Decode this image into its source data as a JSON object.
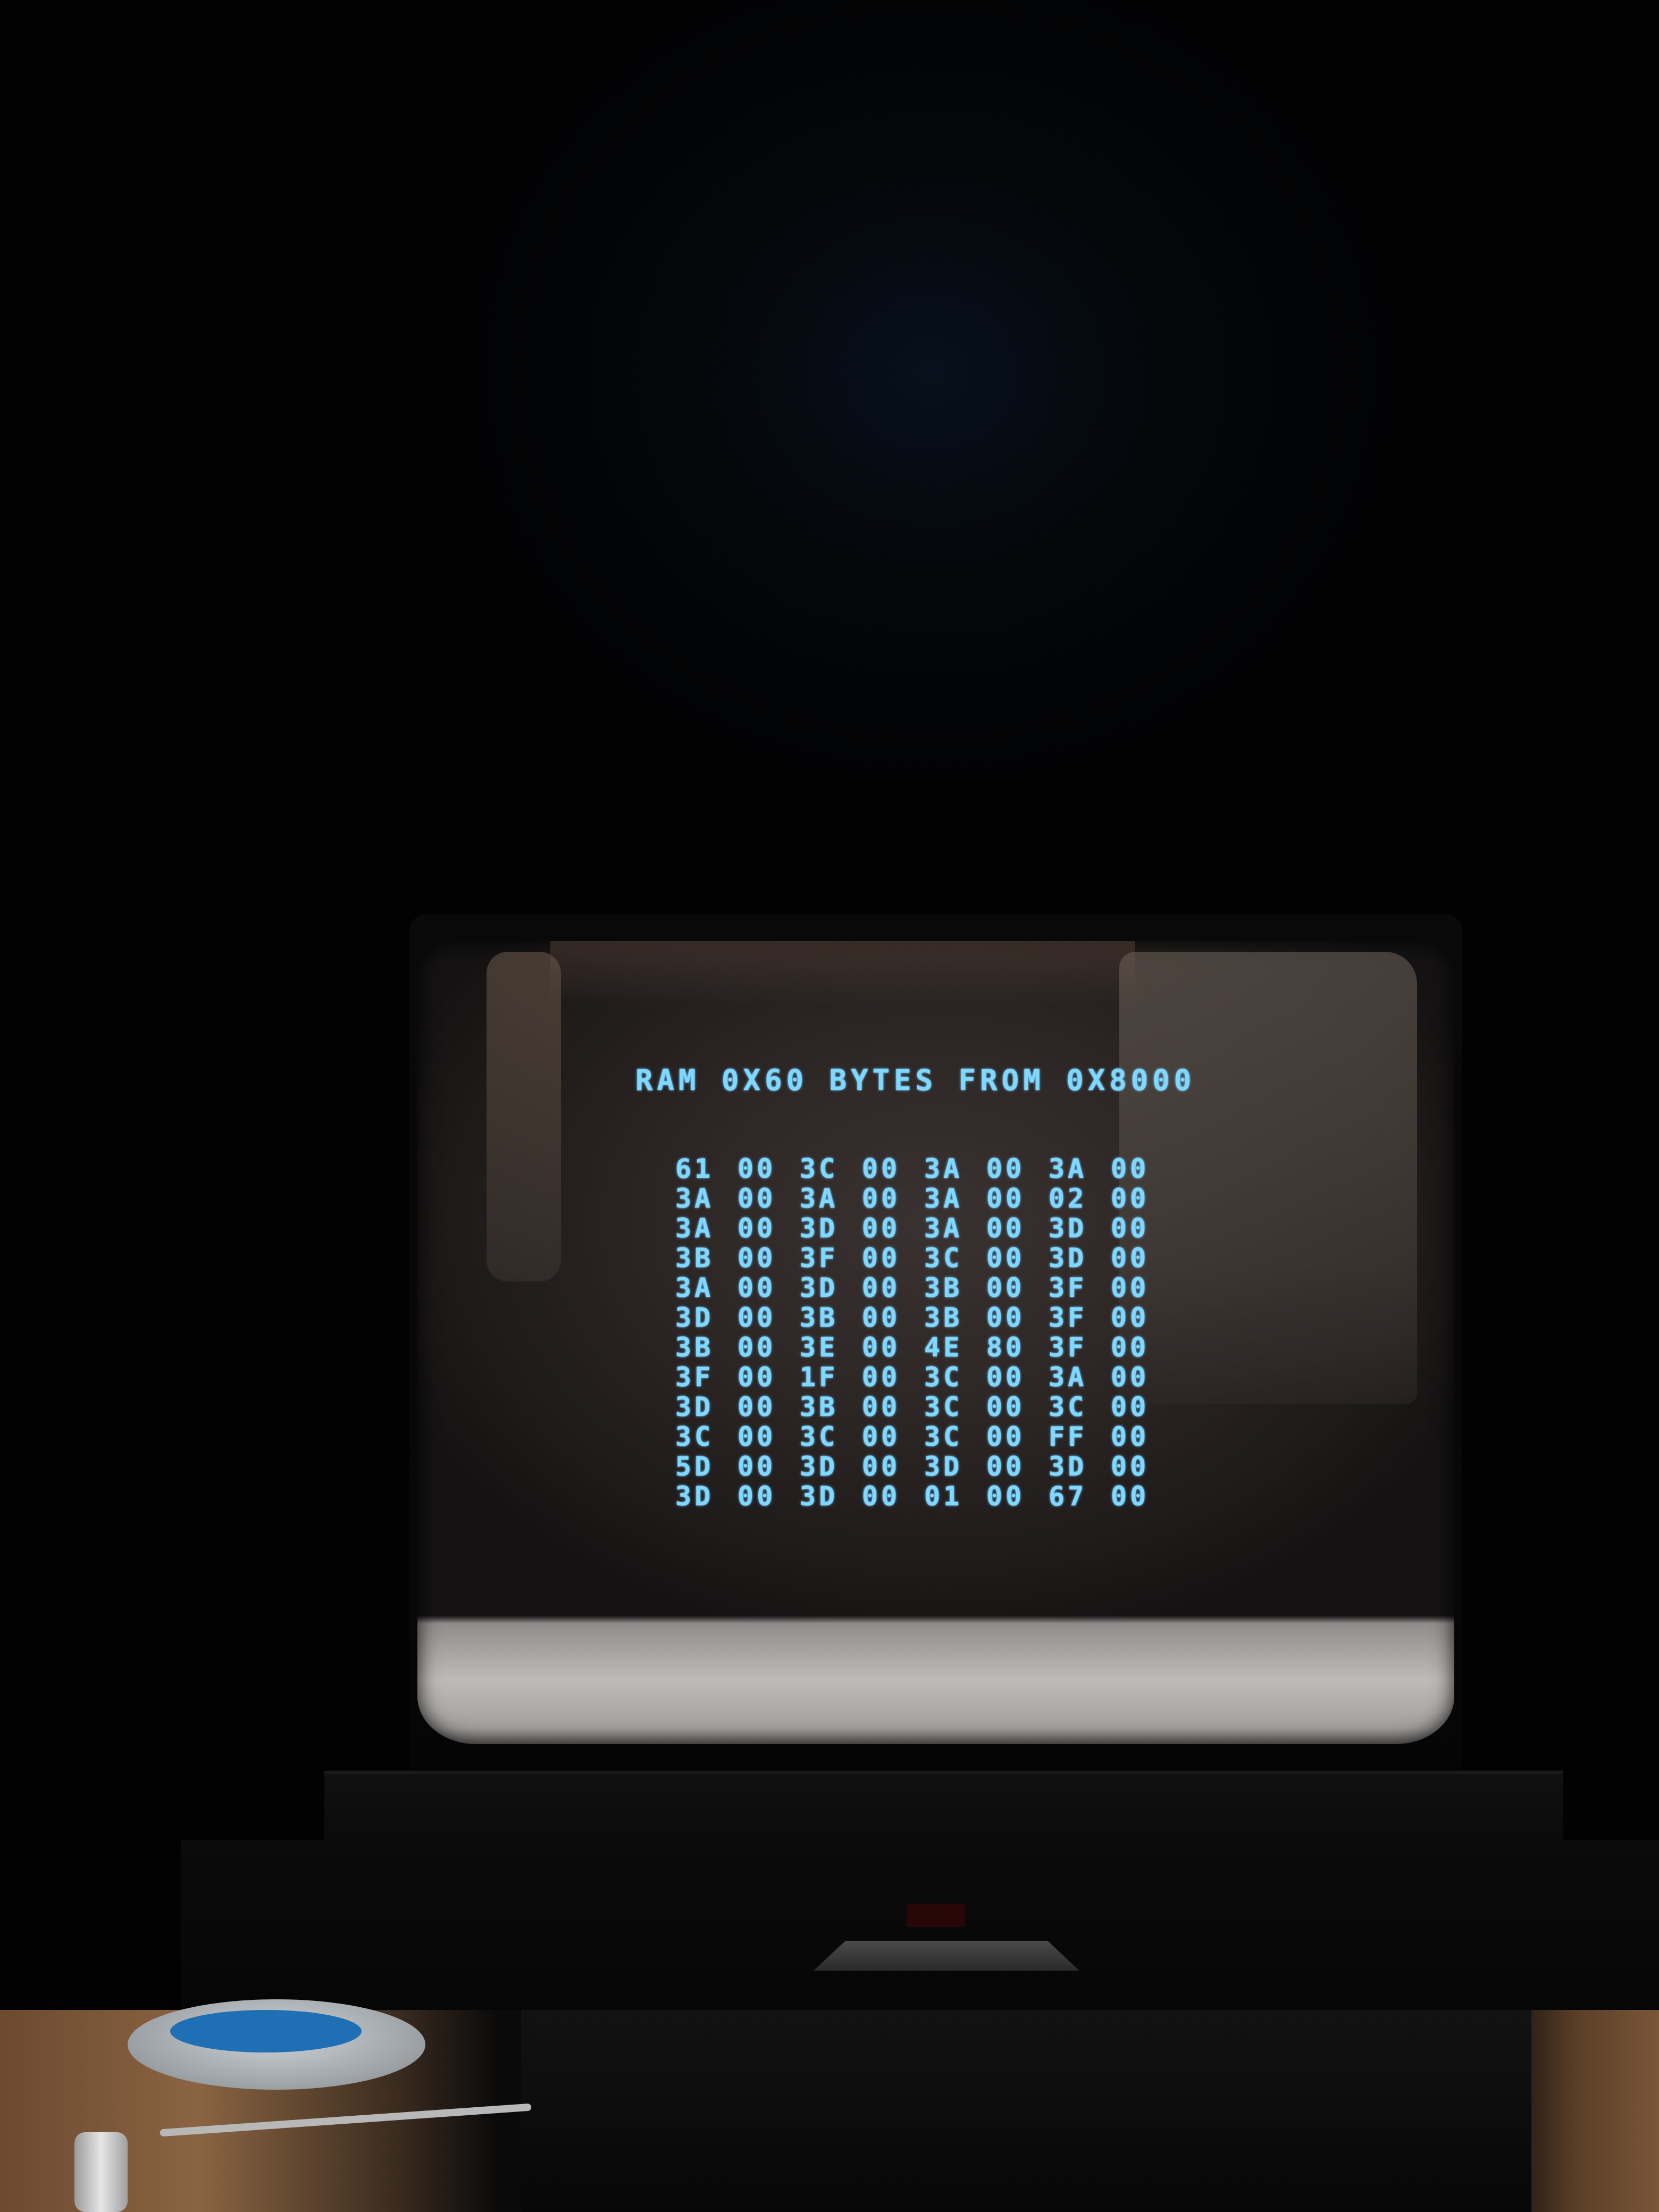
{
  "screen": {
    "title": "RAM 0X60 BYTES FROM 0X8000",
    "rows": [
      [
        "61",
        "00",
        "3C",
        "00",
        "3A",
        "00",
        "3A",
        "00"
      ],
      [
        "3A",
        "00",
        "3A",
        "00",
        "3A",
        "00",
        "02",
        "00"
      ],
      [
        "3A",
        "00",
        "3D",
        "00",
        "3A",
        "00",
        "3D",
        "00"
      ],
      [
        "3B",
        "00",
        "3F",
        "00",
        "3C",
        "00",
        "3D",
        "00"
      ],
      [
        "3A",
        "00",
        "3D",
        "00",
        "3B",
        "00",
        "3F",
        "00"
      ],
      [
        "3D",
        "00",
        "3B",
        "00",
        "3B",
        "00",
        "3F",
        "00"
      ],
      [
        "3B",
        "00",
        "3E",
        "00",
        "4E",
        "80",
        "3F",
        "00"
      ],
      [
        "3F",
        "00",
        "1F",
        "00",
        "3C",
        "00",
        "3A",
        "00"
      ],
      [
        "3D",
        "00",
        "3B",
        "00",
        "3C",
        "00",
        "3C",
        "00"
      ],
      [
        "3C",
        "00",
        "3C",
        "00",
        "3C",
        "00",
        "FF",
        "00"
      ],
      [
        "5D",
        "00",
        "3D",
        "00",
        "3D",
        "00",
        "3D",
        "00"
      ],
      [
        "3D",
        "00",
        "3D",
        "00",
        "01",
        "00",
        "67",
        "00"
      ]
    ]
  },
  "colors": {
    "phosphor_text": "#7fd8ff",
    "crt_background": "#2c2624",
    "room_background": "#020203"
  }
}
